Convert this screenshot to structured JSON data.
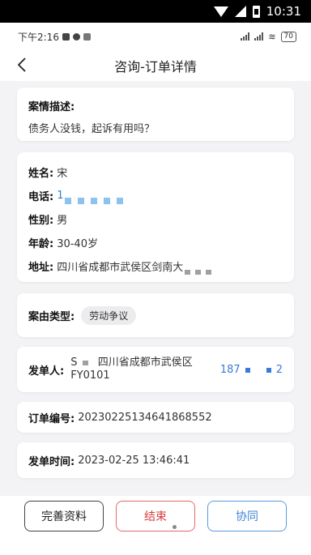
{
  "system_bar": {
    "time": "10:31"
  },
  "phone_status": {
    "time": "下午2:16",
    "battery": "70"
  },
  "nav": {
    "title": "咨询-订单详情"
  },
  "case": {
    "label": "案情描述:",
    "value": "债务人没钱，起诉有用吗？"
  },
  "info": {
    "name_label": "姓名:",
    "name_value": "宋",
    "phone_label": "电话:",
    "phone_value": "1",
    "gender_label": "性别:",
    "gender_value": "男",
    "age_label": "年龄:",
    "age_value": "30-40岁",
    "address_label": "地址:",
    "address_value": "四川省成都市武侯区剑南大"
  },
  "case_type": {
    "label": "案由类型:",
    "tag": "劳动争议"
  },
  "issuer": {
    "label": "发单人:",
    "line1_prefix": "S",
    "line1_rest": "四川省成都市武侯区",
    "line2": "FY0101",
    "phone_prefix": "187",
    "phone_suffix": "2"
  },
  "order_no": {
    "label": "订单编号:",
    "value": "20230225134641868552"
  },
  "issue_time": {
    "label": "发单时间:",
    "value": "2023-02-25 13:46:41"
  },
  "buttons": {
    "complete": "完善资料",
    "finish": "结束",
    "collaborate": "协同"
  },
  "colors": {
    "finish": "#d93b3b",
    "collaborate": "#3f86d6",
    "link": "#3a7bd5"
  }
}
